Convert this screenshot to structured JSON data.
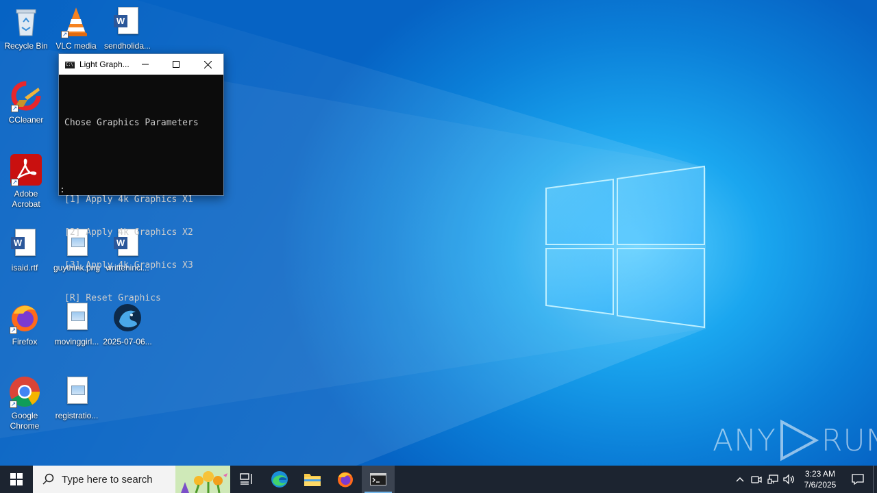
{
  "desktop": {
    "icons": {
      "recycle_bin": "Recycle Bin",
      "vlc": "VLC media",
      "sendholiday": "sendholida...",
      "ccleaner": "CCleaner",
      "adobe": "Adobe Acrobat",
      "isaid": "isaid.rtf",
      "guythink": "guythink.png",
      "writtenincl": "writtenincl...",
      "firefox": "Firefox",
      "movinggirl": "movinggirl...",
      "date_file": "2025-07-06...",
      "chrome": "Google Chrome",
      "registration": "registratio..."
    }
  },
  "console": {
    "title": "Light Graph...",
    "header_line": "Chose Graphics Parameters",
    "options": [
      "[1] Apply 4k Graphics X1",
      "[2] Apply 4k Graphics X2",
      "[3] Apply 4k Graphics X3",
      "[R] Reset Graphics"
    ],
    "prompt": ":"
  },
  "watermark": {
    "left": "ANY",
    "right": "RUN"
  },
  "taskbar": {
    "search_placeholder": "Type here to search",
    "clock_time": "3:23 AM",
    "clock_date": "7/6/2025"
  },
  "colors": {
    "taskbar_bg": "#1c2430",
    "console_bg": "#0c0c0c",
    "console_text": "#cccccc",
    "accent": "#76b9ed"
  }
}
